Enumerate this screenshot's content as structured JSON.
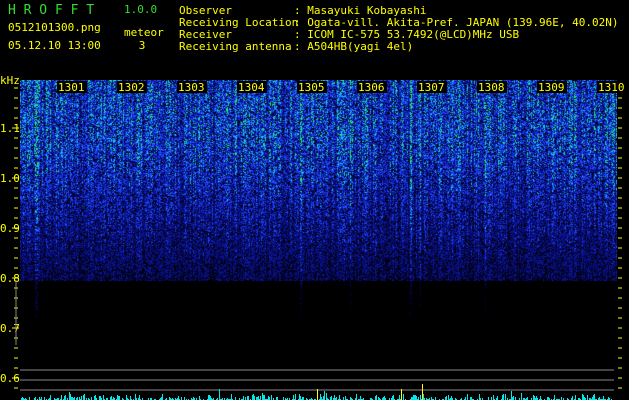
{
  "app": {
    "title": "H R O F F T",
    "version": "1.0.0"
  },
  "file": {
    "name": "0512101300.png",
    "datetime": "05.12.10 13:00"
  },
  "meteor": {
    "label": "meteor",
    "count": "3"
  },
  "info": [
    {
      "label": "Observer",
      "value": ": Masayuki Kobayashi"
    },
    {
      "label": "Receiving Location",
      "value": ": Ogata-vill. Akita-Pref. JAPAN (139.96E, 40.02N)"
    },
    {
      "label": "Receiver",
      "value": ": ICOM IC-575 53.7492(@LCD)MHz USB"
    },
    {
      "label": "Receiving antenna",
      "value": ": A504HB(yagi 4el)"
    }
  ],
  "spectrogram": {
    "y_unit": "kHz",
    "y_ticks": [
      "1.1",
      "1.0",
      "0.9",
      "0.8",
      "0.7",
      "0.6"
    ],
    "y_range": [
      0.58,
      1.2
    ],
    "time_labels": [
      "1301",
      "1302",
      "1303",
      "1304",
      "1305",
      "1306",
      "1307",
      "1308",
      "1309",
      "1310"
    ],
    "colors": {
      "background": "#000000",
      "low": "#0a1a8a",
      "mid": "#2255ff",
      "high": "#22ff66",
      "label": "#ffff00",
      "histogram": "#00e8e8",
      "guide": "#888888"
    }
  }
}
